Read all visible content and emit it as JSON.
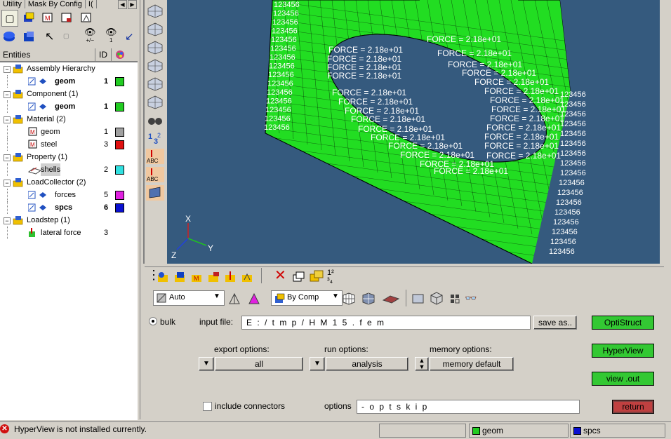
{
  "window": {
    "tabs": [
      "Utility",
      "Mask By Config",
      "I("
    ]
  },
  "tree": {
    "header": {
      "entities": "Entities",
      "id": "ID"
    },
    "rows": [
      {
        "label": "Assembly Hierarchy",
        "level": 0,
        "color": ""
      },
      {
        "label": "geom",
        "level": 1,
        "id": "1",
        "bold": true,
        "color": "#22cc22"
      },
      {
        "label": "Component (1)",
        "level": 0,
        "color": ""
      },
      {
        "label": "geom",
        "level": 1,
        "id": "1",
        "bold": true,
        "color": "#22cc22"
      },
      {
        "label": "Material (2)",
        "level": 0,
        "color": ""
      },
      {
        "label": "geom",
        "level": 1,
        "id": "1",
        "bold": false,
        "color": "#a0a0a0"
      },
      {
        "label": "steel",
        "level": 1,
        "id": "3",
        "bold": false,
        "color": "#e01010"
      },
      {
        "label": "Property (1)",
        "level": 0,
        "color": ""
      },
      {
        "label": "shells",
        "level": 1,
        "id": "2",
        "bold": false,
        "color": "#30e0e0"
      },
      {
        "label": "LoadCollector (2)",
        "level": 0,
        "color": ""
      },
      {
        "label": "forces",
        "level": 1,
        "id": "5",
        "bold": false,
        "color": "#e020e0"
      },
      {
        "label": "spcs",
        "level": 1,
        "id": "6",
        "bold": true,
        "color": "#0a10d0"
      },
      {
        "label": "Loadstep (1)",
        "level": 0,
        "color": ""
      },
      {
        "label": "lateral force",
        "level": 1,
        "id": "3",
        "bold": false,
        "color": ""
      }
    ]
  },
  "viewport": {
    "force_label": "FORCE = 2.18e+01",
    "constraint_label": "123456",
    "axes": {
      "x": "X",
      "y": "Y",
      "z": "Z"
    },
    "mesh_color": "#22dd22",
    "background": "#355a7e"
  },
  "toolbar2": {
    "mode": "Auto",
    "color_by": "By Comp"
  },
  "panel": {
    "radio_label": "bulk",
    "input_file_label": "input file:",
    "input_file_value": "E : / t m p / H M 1 5 . f e m",
    "save_as": "save as..",
    "export_options_label": "export options:",
    "export_options_value": "all",
    "run_options_label": "run options:",
    "run_options_value": "analysis",
    "memory_options_label": "memory options:",
    "memory_options_value": "memory default",
    "include_connectors": "include connectors",
    "options_label": "options",
    "options_value": "- o p t s k i p",
    "btn_optistruct": "OptiStruct",
    "btn_hyperview": "HyperView",
    "btn_viewout": "view .out",
    "btn_return": "return"
  },
  "status": {
    "message": "HyperView is not installed currently.",
    "component": "geom",
    "loadcol": "spcs",
    "component_color": "#22cc22",
    "loadcol_color": "#0a10d0"
  }
}
